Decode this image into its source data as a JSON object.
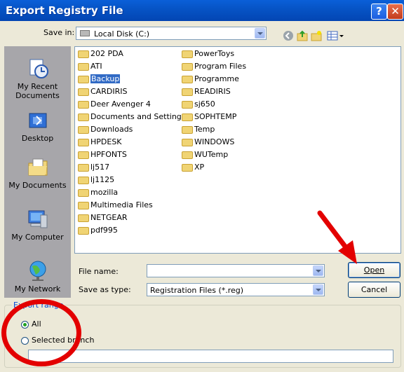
{
  "window": {
    "title": "Export Registry File",
    "help_label": "?",
    "close_label": "✕"
  },
  "save_in": {
    "label": "Save in:",
    "value": "Local Disk (C:)"
  },
  "places": [
    "My Recent Documents",
    "Desktop",
    "My Documents",
    "My Computer",
    "My Network"
  ],
  "files_col1": [
    "202 PDA",
    "ATI",
    "Backup",
    "CARDIRIS",
    "Deer Avenger 4",
    "Documents and Settings",
    "Downloads",
    "HPDESK",
    "HPFONTS",
    "lj517",
    "lj1125",
    "mozilla",
    "Multimedia Files",
    "NETGEAR",
    "pdf995"
  ],
  "files_col2": [
    "PowerToys",
    "Program Files",
    "Programme",
    "READIRIS",
    "sj650",
    "SOPHTEMP",
    "Temp",
    "WINDOWS",
    "WUTemp",
    "XP"
  ],
  "selected_file": "Backup",
  "file_name": {
    "label": "File name:",
    "value": ""
  },
  "save_type": {
    "label": "Save as type:",
    "value": "Registration Files (*.reg)"
  },
  "buttons": {
    "open": "Open",
    "cancel": "Cancel"
  },
  "export_range": {
    "legend": "Export range",
    "all": "All",
    "branch": "Selected branch",
    "branch_value": ""
  },
  "annotation_color": "#e30000"
}
